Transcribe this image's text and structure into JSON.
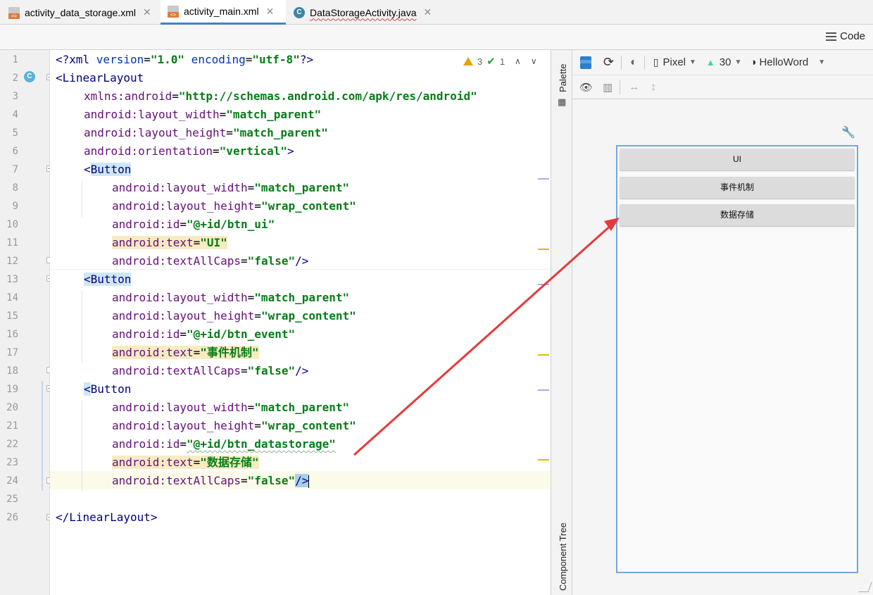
{
  "tabs": [
    {
      "label": "activity_data_storage.xml",
      "icon": "xml-file-icon",
      "active": false
    },
    {
      "label": "activity_main.xml",
      "icon": "xml-file-icon",
      "active": true
    },
    {
      "label": "DataStorageActivity.java",
      "icon": "java-class-icon",
      "active": false
    }
  ],
  "toolbar": {
    "code_label": "Code"
  },
  "inspections": {
    "warnings": "3",
    "weak_warnings": "1"
  },
  "line_numbers": [
    "1",
    "2",
    "3",
    "4",
    "5",
    "6",
    "7",
    "8",
    "9",
    "10",
    "11",
    "12",
    "13",
    "14",
    "15",
    "16",
    "17",
    "18",
    "19",
    "20",
    "21",
    "22",
    "23",
    "24",
    "25",
    "26"
  ],
  "code": {
    "l1": {
      "a": "<?xml ",
      "b": "version",
      "c": "=",
      "d": "\"1.0\"",
      "e": " encoding",
      "f": "=",
      "g": "\"utf-8\"",
      "h": "?>"
    },
    "l2": {
      "tag": "<LinearLayout"
    },
    "l3": {
      "attr": "xmlns:android",
      "eq": "=",
      "val": "\"http://schemas.android.com/apk/res/android\""
    },
    "l4": {
      "attr": "android:layout_width",
      "eq": "=",
      "val": "\"match_parent\""
    },
    "l5": {
      "attr": "android:layout_height",
      "eq": "=",
      "val": "\"match_parent\""
    },
    "l6": {
      "attr": "android:orientation",
      "eq": "=",
      "val": "\"vertical\"",
      "end": ">"
    },
    "l7": {
      "lt": "<",
      "tag": "Button"
    },
    "l8": {
      "attr": "android:layout_width",
      "eq": "=",
      "val": "\"match_parent\""
    },
    "l9": {
      "attr": "android:layout_height",
      "eq": "=",
      "val": "\"wrap_content\""
    },
    "l10": {
      "attr": "android:id",
      "eq": "=",
      "val": "\"@+id/btn_ui\""
    },
    "l11": {
      "attr": "android:text",
      "eq": "=",
      "val": "\"UI\""
    },
    "l12": {
      "attr": "android:textAllCaps",
      "eq": "=",
      "val": "\"false\"",
      "end": "/>"
    },
    "l13": {
      "lt": "<",
      "tag": "Button"
    },
    "l14": {
      "attr": "android:layout_width",
      "eq": "=",
      "val": "\"match_parent\""
    },
    "l15": {
      "attr": "android:layout_height",
      "eq": "=",
      "val": "\"wrap_content\""
    },
    "l16": {
      "attr": "android:id",
      "eq": "=",
      "val": "\"@+id/btn_event\""
    },
    "l17": {
      "attr": "android:text",
      "eq": "=",
      "val": "\"事件机制\""
    },
    "l18": {
      "attr": "android:textAllCaps",
      "eq": "=",
      "val": "\"false\"",
      "end": "/>"
    },
    "l19": {
      "lt": "<",
      "tag": "Button"
    },
    "l20": {
      "attr": "android:layout_width",
      "eq": "=",
      "val": "\"match_parent\""
    },
    "l21": {
      "attr": "android:layout_height",
      "eq": "=",
      "val": "\"wrap_content\""
    },
    "l22": {
      "attr": "android:id",
      "eq": "=",
      "val": "\"@+id/btn_datastorage\""
    },
    "l23": {
      "attr": "android:text",
      "eq": "=",
      "val": "\"数据存储\""
    },
    "l24": {
      "attr": "android:textAllCaps",
      "eq": "=",
      "val": "\"false\"",
      "end": "/>"
    },
    "l26": {
      "tag": "</LinearLayout>"
    }
  },
  "side_rail": {
    "palette": "Palette",
    "component_tree": "Component Tree"
  },
  "design_toolbar": {
    "device": "Pixel",
    "api": "30",
    "theme": "HelloWord"
  },
  "preview_buttons": [
    "UI",
    "事件机制",
    "数据存储"
  ],
  "colors": {
    "accent": "#4083c9",
    "string": "#067d17",
    "attribute": "#660e7a",
    "tag": "#000080",
    "annotation_arrow": "#e8383b"
  }
}
